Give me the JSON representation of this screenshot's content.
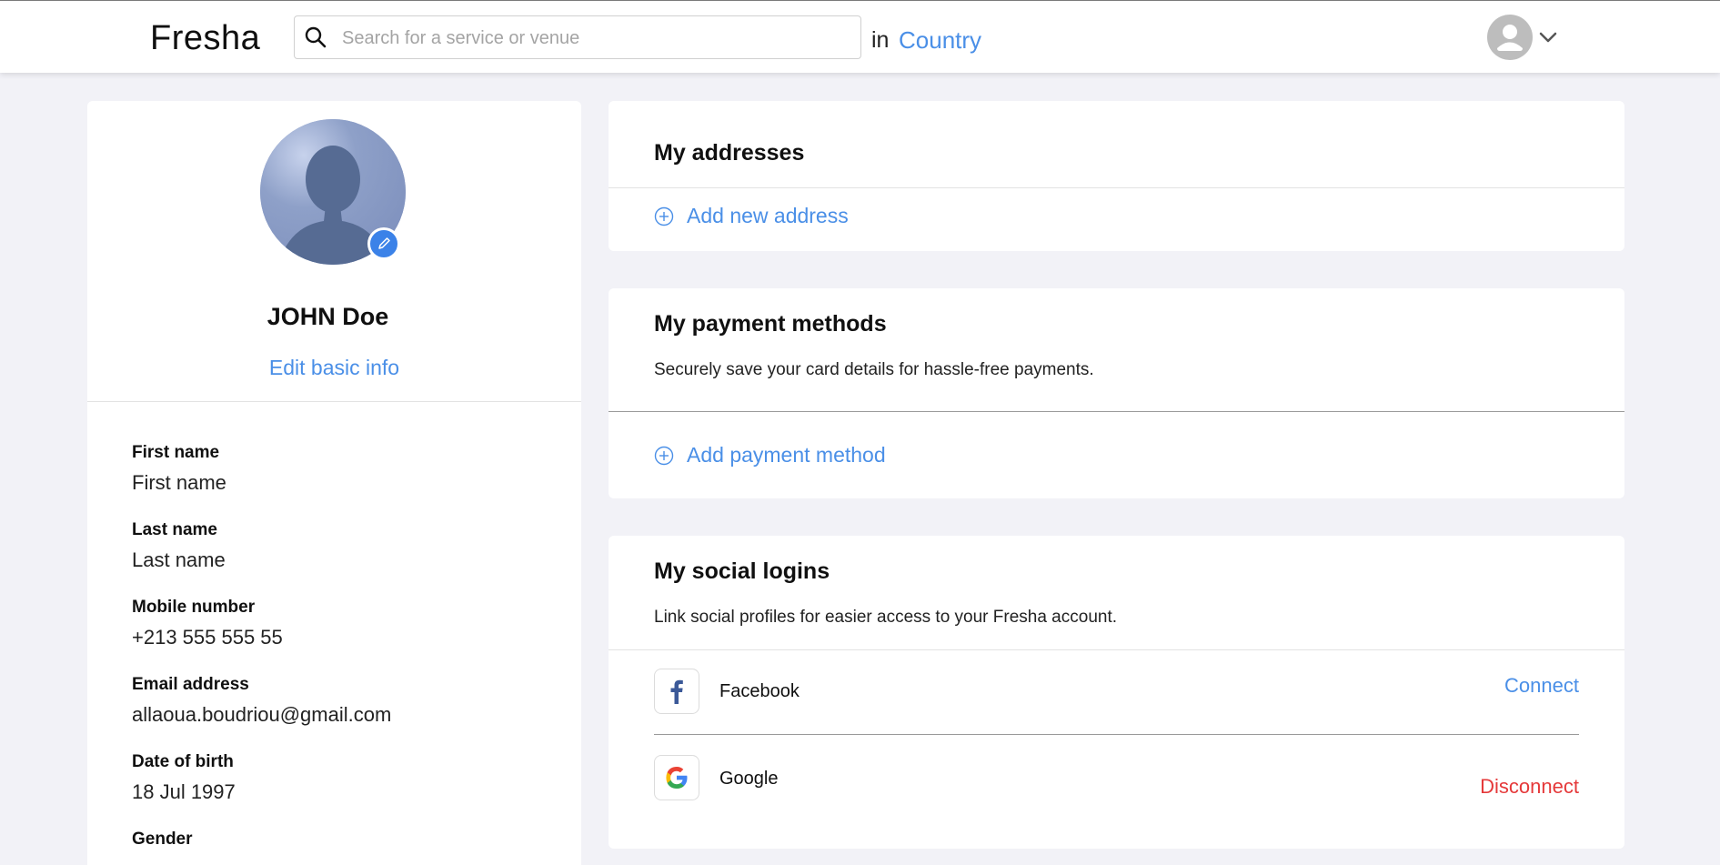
{
  "header": {
    "logo": "Fresha",
    "search_placeholder": "Search for a service or venue",
    "search_value": "",
    "in_label": "in",
    "country_label": "Country"
  },
  "profile": {
    "name": "JOHN Doe",
    "edit_basic_info": "Edit basic info",
    "fields": [
      {
        "label": "First name",
        "value": "First name"
      },
      {
        "label": "Last name",
        "value": "Last name"
      },
      {
        "label": "Mobile number",
        "value": "+213 555 555 55"
      },
      {
        "label": "Email address",
        "value": "allaoua.boudriou@gmail.com"
      },
      {
        "label": "Date of birth",
        "value": "18 Jul 1997"
      },
      {
        "label": "Gender",
        "value": ""
      }
    ]
  },
  "addresses": {
    "title": "My addresses",
    "add_label": "Add new address"
  },
  "payment": {
    "title": "My payment methods",
    "description": "Securely save your card details for hassle-free payments.",
    "add_label": "Add payment method"
  },
  "social": {
    "title": "My social logins",
    "description": "Link social profiles for easier access to your Fresha account.",
    "items": [
      {
        "name": "Facebook",
        "action": "Connect",
        "icon": "facebook-icon"
      },
      {
        "name": "Google",
        "action": "Disconnect",
        "icon": "google-icon"
      }
    ]
  },
  "colors": {
    "accent": "#4a8fe7",
    "danger": "#e5393a",
    "background": "#f2f2f7",
    "edit_badge": "#3b82e8"
  }
}
